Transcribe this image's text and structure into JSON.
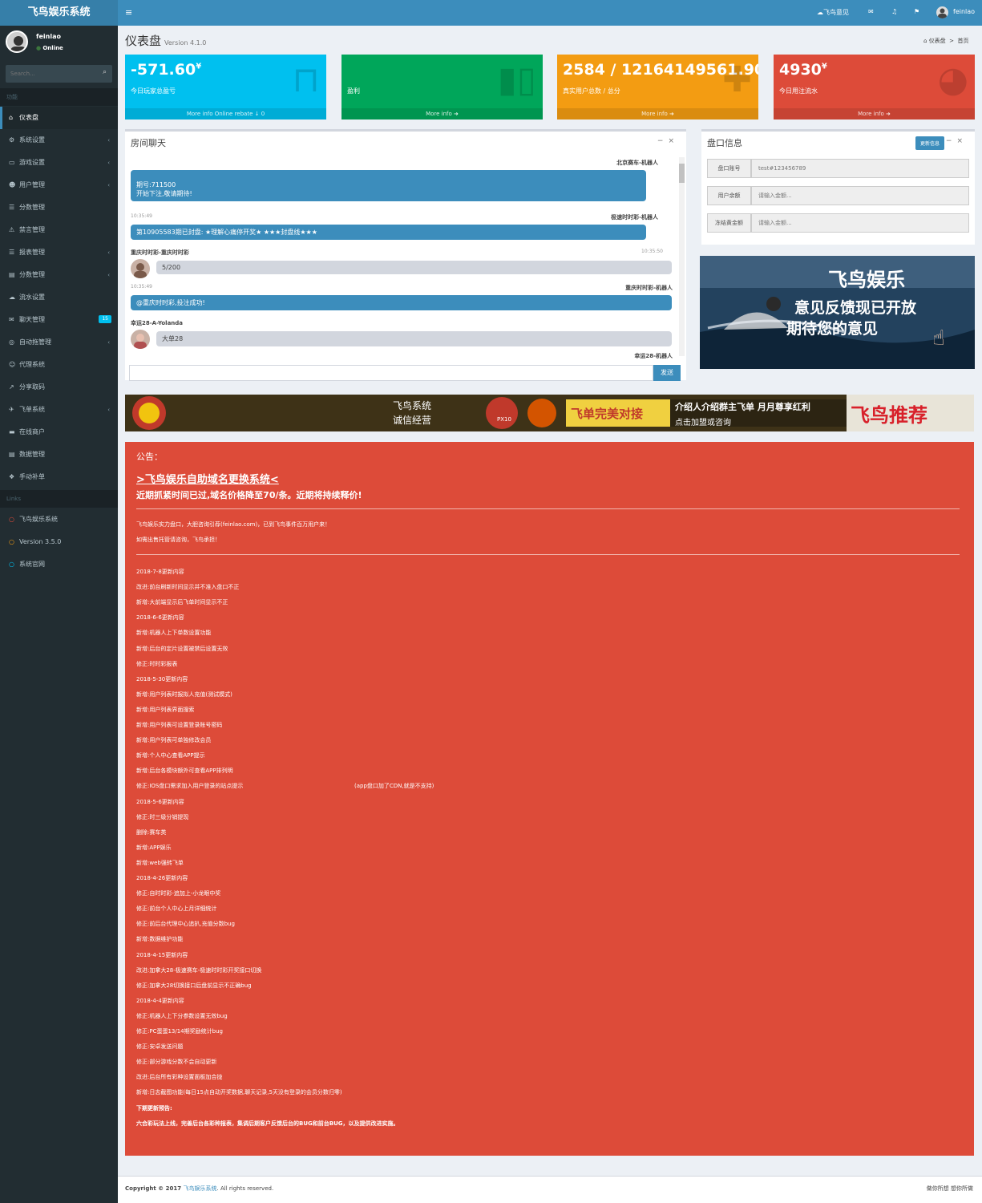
{
  "header": {
    "logo": "飞鸟娱乐系统",
    "toggle": "≡",
    "feedback": "飞鸟意见",
    "username": "feinlao"
  },
  "sidebar": {
    "user": {
      "name": "feinlao",
      "status": "Online"
    },
    "search_placeholder": "Search...",
    "header1": "功能",
    "items": [
      {
        "label": "仪表盘",
        "icon": "dashboard-icon"
      },
      {
        "label": "系统设置",
        "icon": "cogs-icon"
      },
      {
        "label": "游戏设置",
        "icon": "gamepad-icon"
      },
      {
        "label": "用户管理",
        "icon": "users-icon"
      },
      {
        "label": "分数管理",
        "icon": "list-icon"
      },
      {
        "label": "禁言管理",
        "icon": "warning-icon"
      },
      {
        "label": "报表管理",
        "icon": "list-icon"
      },
      {
        "label": "分数管理",
        "icon": "file-icon"
      },
      {
        "label": "流水设置",
        "icon": "cloud-icon"
      },
      {
        "label": "聊天管理",
        "icon": "comments-icon",
        "badge": "15"
      },
      {
        "label": "自动拖管理",
        "icon": "circle-icon"
      },
      {
        "label": "代理系统",
        "icon": "user-plus-icon"
      },
      {
        "label": "分享取码",
        "icon": "share-icon"
      },
      {
        "label": "飞单系统",
        "icon": "plane-icon"
      },
      {
        "label": "在线商户",
        "icon": "cart-icon"
      },
      {
        "label": "数据管理",
        "icon": "file-icon"
      },
      {
        "label": "手动补单",
        "icon": "cubes-icon"
      }
    ],
    "header2": "Links",
    "links": [
      {
        "label": "飞鸟娱乐系统",
        "color": "#dd4b39"
      },
      {
        "label": "Version 3.5.0",
        "color": "#f39c12"
      },
      {
        "label": "系统官网",
        "color": "#00c0ef"
      }
    ]
  },
  "page": {
    "title": "仪表盘",
    "version": "Version 4.1.0",
    "breadcrumb": [
      "仪表盘",
      "首页"
    ]
  },
  "stats": [
    {
      "value": "-571.60",
      "unit": "¥",
      "label": "今日玩家总盈亏",
      "footer": "More info Online rebate ↓ 0",
      "color": "#00c0ef",
      "icon": "bag-icon"
    },
    {
      "value": "",
      "unit": "",
      "label": "盈利",
      "footer": "More info",
      "color": "#00a65a",
      "icon": "bar-chart-icon"
    },
    {
      "value": "2584 / 12164149561.90",
      "unit": "",
      "label": "真实用户总数 / 总分",
      "footer": "More info",
      "color": "#f39c12",
      "icon": "user-add-icon"
    },
    {
      "value": "4930",
      "unit": "¥",
      "label": "今日用注流水",
      "footer": "More info",
      "color": "#dd4b39",
      "icon": "pie-chart-icon"
    }
  ],
  "chat": {
    "title": "房间聊天",
    "send": "发送",
    "messages": [
      {
        "name": "北京赛车-机器人",
        "time": "",
        "lines": [
          "期号:711500",
          "开始下注,敬请期待!"
        ]
      },
      {
        "name": "极速时时彩-机器人",
        "time": "10:35:49",
        "lines": [
          "第10905583期已封盘: ★理解心痛停开奖★ ★★★封盘线★★★"
        ]
      },
      {
        "name": "重庆时时彩-重庆时时彩",
        "time": "10:35:50",
        "lines": [
          "5/200"
        ]
      },
      {
        "name": "重庆时时彩-机器人",
        "time": "10:35:49",
        "lines": [
          "@重庆时时彩,投注成功!"
        ]
      },
      {
        "name": "幸运28-A-Yolanda",
        "time": "",
        "lines": [
          "大单28"
        ]
      },
      {
        "name": "幸运28-机器人",
        "time": "",
        "lines": []
      }
    ]
  },
  "pan": {
    "title": "盘口信息",
    "button": "更新信息",
    "rows": [
      {
        "key": "盘口账号",
        "value": "test#123456789"
      },
      {
        "key": "用户余额",
        "value": "请输入金额..."
      },
      {
        "key": "冻结黄金额",
        "value": "请输入金额..."
      }
    ]
  },
  "promo": {
    "line1": "飞鸟娱乐",
    "line2": "意见反馈现已开放",
    "line3": "期待您的意见"
  },
  "banner": {
    "t1": "飞鸟系统",
    "t2": "诚信经营",
    "t3": "飞单完美对接",
    "t4": "介绍人介绍群主飞单 月月尊享红利",
    "t5": "点击加盟或咨询",
    "t6": "飞鸟推荐",
    "t7": "PX10"
  },
  "notice": {
    "label": "公告：",
    "headline": ">飞鸟娱乐自助域名更换系统<",
    "subline": "近期抓紧时间已过,域名价格降至70/条。近期将持续释价!",
    "intro": [
      "飞鸟娱乐实力盘口，大胆咨询引荐(feinlao.com)，已到飞鸟事件百万用户来！",
      "如需出售托管请咨询，飞鸟承担！"
    ],
    "logs": [
      "2018-7-8更新内容",
      "改进:前台刷新时间显示并不准入盘口不正",
      "新增:大前端显示后飞单时间显示不正",
      "2018-6-6更新内容",
      "新增:机器人上下单数设置功能",
      "新增:后台的定片设置被禁后设置无效",
      "修正:时时彩报表",
      "2018-5-30更新内容",
      "新增:用户列表时报拟人充值(测试模式)",
      "新增:用户列表界面搜索",
      "新增:用户列表可设置登录账号密码",
      "新增:用户列表可单独修改会员",
      "新增:个人中心查看APP提示",
      "新增:后台各模块额外可查看APP排列明",
      "修正:IOS盘口需求加入用户登录的站点提示",
      "2018-5-6更新内容",
      "修正:时三级分销提现",
      "删除:赛车类",
      "新增:APP娱乐",
      "新增:web强转飞单",
      "2018-4-26更新内容",
      "修正:自时时彩-追加上-小龙眼中奖",
      "修正:前台个人中心上月详细统计",
      "修正:前后台代理中心追扒,充值分数bug",
      "新增:数据维护功能",
      "2018-4-15更新内容",
      "改进:加拿大28-极速赛车-极速时时彩开奖接口切换",
      "修正:加拿大28切换接口后盘前显示不正确bug",
      "2018-4-4更新内容",
      "修正:机器人上下分参数设置无效bug",
      "修正:PC蛋蛋13/14期奖励统计bug",
      "修正:安卓发送问题",
      "修正:部分游戏分数不会自动更新",
      "改进:后台所有彩种设置面板加合拢",
      "新增:日志截图功能(每日15点自动开奖数据,聊天记录,5天没有登录的会员分数归零)",
      "下期更新预告:",
      "六合彩玩法上线，完善后台各彩种报表，集调后期客户反馈后台的BUG和前台BUG，以及提供改进实施。"
    ],
    "cdn_note": "(app盘口加了CDN,就是不支持)"
  },
  "footer": {
    "copyright": "Copyright © 2017 ",
    "link": "飞鸟娱乐系统",
    "rights": ". All rights reserved.",
    "right": "做你所想 想你所做"
  }
}
